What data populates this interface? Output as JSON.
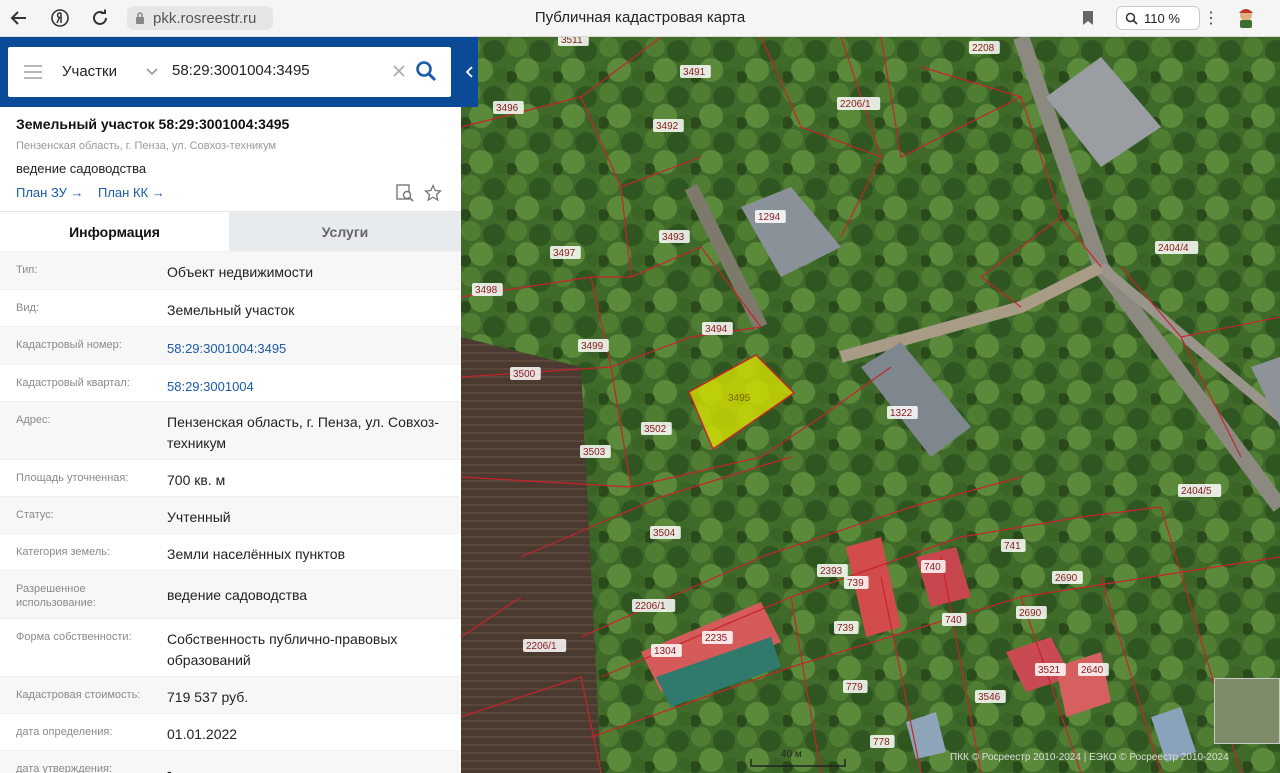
{
  "browser": {
    "url": "pkk.rosreestr.ru",
    "page_title": "Публичная кадастровая карта",
    "zoom": "110 %"
  },
  "search": {
    "category": "Участки",
    "query": "58:29:3001004:3495"
  },
  "object": {
    "title": "Земельный участок 58:29:3001004:3495",
    "address_short": "Пензенская область, г. Пенза, ул. Совхоз-техникум",
    "use": "ведение садоводства",
    "plan_zu": "План ЗУ →",
    "plan_kk": "План КК →"
  },
  "tabs": {
    "info": "Информация",
    "services": "Услуги"
  },
  "attributes": [
    {
      "label": "Тип:",
      "value": "Объект недвижимости"
    },
    {
      "label": "Вид:",
      "value": "Земельный участок"
    },
    {
      "label": "Кадастровый номер:",
      "value": "58:29:3001004:3495"
    },
    {
      "label": "Кадастровый квартал:",
      "value": "58:29:3001004"
    },
    {
      "label": "Адрес:",
      "value": "Пензенская область, г. Пенза, ул. Совхоз-техникум"
    },
    {
      "label": "Площадь уточненная:",
      "value": "700 кв. м"
    },
    {
      "label": "Статус:",
      "value": "Учтенный"
    },
    {
      "label": "Категория земель:",
      "value": "Земли населённых пунктов"
    },
    {
      "label": "Разрешенное использование:",
      "value": "ведение садоводства"
    },
    {
      "label": "Форма собственности:",
      "value": "Собственность публично-правовых образований"
    },
    {
      "label": "Кадастровая стоимость:",
      "value": "719 537 руб."
    },
    {
      "label": "дата определения:",
      "value": "01.01.2022"
    },
    {
      "label": "дата утверждения:",
      "value": "-"
    }
  ],
  "map": {
    "selected_parcel": "3495",
    "parcel_labels": [
      "3511",
      "3491",
      "2208",
      "3496",
      "3492",
      "2206/1",
      "3497",
      "3493",
      "1294",
      "2404/4",
      "3498",
      "3494",
      "3499",
      "3500",
      "1322",
      "3502",
      "3503",
      "3504",
      "2404/5",
      "741",
      "2393",
      "739",
      "740",
      "2690",
      "2206/1",
      "2235",
      "1304",
      "739",
      "740",
      "2690",
      "3521",
      "2640",
      "779",
      "3546",
      "778",
      "2206/1"
    ],
    "scale": "40 м",
    "copyright": "ПКК © Росреестр 2010-2024 | ЕЭКО © Росреестр 2010-2024",
    "colors": {
      "boundary": "#c8232b",
      "selected_fill": "#d6e000",
      "label_bg": "#ffffff"
    }
  }
}
